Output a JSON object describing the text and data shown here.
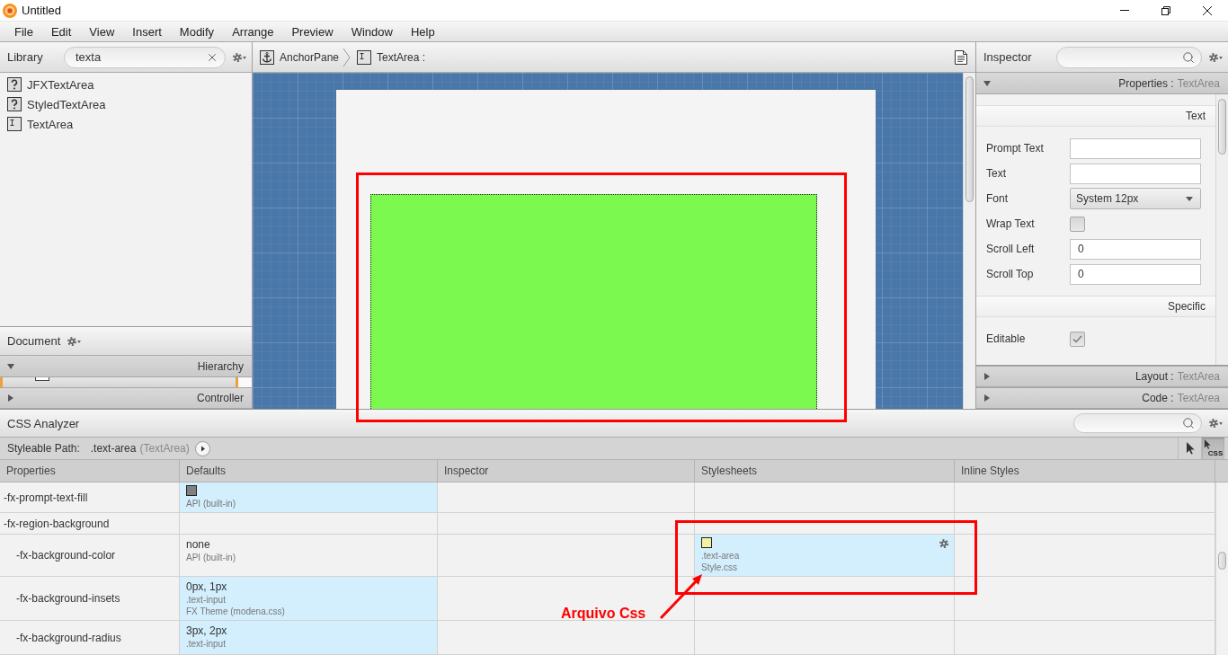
{
  "window": {
    "title": "Untitled"
  },
  "menu": [
    "File",
    "Edit",
    "View",
    "Insert",
    "Modify",
    "Arrange",
    "Preview",
    "Window",
    "Help"
  ],
  "library": {
    "title": "Library",
    "search": {
      "value": "texta"
    },
    "items": [
      {
        "label": "JFXTextArea",
        "kind": "custom"
      },
      {
        "label": "StyledTextArea",
        "kind": "custom"
      },
      {
        "label": "TextArea",
        "kind": "text-area"
      }
    ]
  },
  "document": {
    "title": "Document",
    "sections": [
      {
        "title": "Hierarchy",
        "expanded": true
      },
      {
        "title": "Controller",
        "expanded": false
      }
    ]
  },
  "breadcrumb": [
    {
      "label": "AnchorPane",
      "kind": "anchor-pane"
    },
    {
      "label": "TextArea :",
      "kind": "text-area"
    }
  ],
  "inspector": {
    "title": "Inspector",
    "sections": [
      {
        "title": "Properties :",
        "target": "TextArea",
        "expanded": true,
        "groups": [
          {
            "title": "Text",
            "rows": [
              {
                "label": "Prompt Text",
                "kind": "text"
              },
              {
                "label": "Text",
                "kind": "text"
              },
              {
                "label": "Font",
                "kind": "dropdown",
                "value": "System 12px"
              },
              {
                "label": "Wrap Text",
                "kind": "checkbox",
                "checked": false
              },
              {
                "label": "Scroll Left",
                "kind": "text",
                "value": "0"
              },
              {
                "label": "Scroll Top",
                "kind": "text",
                "value": "0"
              }
            ]
          },
          {
            "title": "Specific",
            "rows": [
              {
                "label": "Editable",
                "kind": "checkbox",
                "checked": true
              }
            ]
          }
        ]
      },
      {
        "title": "Layout :",
        "target": "TextArea",
        "expanded": false
      },
      {
        "title": "Code :",
        "target": "TextArea",
        "expanded": false
      }
    ]
  },
  "css_analyzer": {
    "title": "CSS Analyzer",
    "styleable_path": {
      "label": "Styleable Path:",
      "selector": ".text-area",
      "type": "(TextArea)"
    },
    "pick_modes": [
      {
        "kind": "pointer",
        "selected": false
      },
      {
        "kind": "css",
        "label": "CSS",
        "selected": true
      }
    ],
    "columns": [
      "Properties",
      "Defaults",
      "Inspector",
      "Stylesheets",
      "Inline Styles"
    ],
    "rows": [
      {
        "property": "-fx-prompt-text-fill",
        "defaults": {
          "color": "#808080",
          "sources": [
            "API (built-in)"
          ],
          "highlighted": true
        }
      },
      {
        "property": "-fx-region-background",
        "children": [
          {
            "property": "-fx-background-color",
            "defaults": {
              "value": "none",
              "sources": [
                "API (built-in)"
              ],
              "highlighted": false
            },
            "stylesheets": {
              "color": "#f4f0a4",
              "sources": [
                ".text-area",
                "Style.css"
              ],
              "highlighted": true
            }
          },
          {
            "property": "-fx-background-insets",
            "defaults": {
              "value": "0px, 1px",
              "sources": [
                ".text-input",
                "FX Theme (modena.css)"
              ],
              "highlighted": true
            }
          },
          {
            "property": "-fx-background-radius",
            "defaults": {
              "value": "3px, 2px",
              "sources": [
                ".text-input"
              ],
              "highlighted": true
            }
          }
        ]
      }
    ]
  },
  "annotation": {
    "label": "Arquivo Css"
  }
}
